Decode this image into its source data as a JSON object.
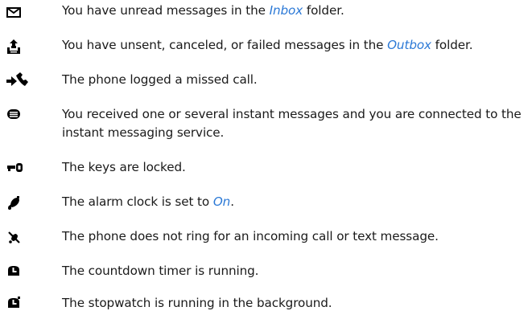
{
  "indicators": [
    {
      "icon": "envelope-icon",
      "pre": "You have unread messages in the ",
      "link": "Inbox",
      "post": " folder."
    },
    {
      "icon": "outbox-icon",
      "pre": "You have unsent, canceled, or failed messages in the ",
      "link": "Outbox",
      "post": " folder."
    },
    {
      "icon": "missed-call-icon",
      "pre": "The phone logged a missed call.",
      "link": "",
      "post": ""
    },
    {
      "icon": "instant-message-icon",
      "pre": "You received one or several instant messages and you are connected to the instant messaging service.",
      "link": "",
      "post": ""
    },
    {
      "icon": "key-lock-icon",
      "pre": "The keys are locked.",
      "link": "",
      "post": ""
    },
    {
      "icon": "alarm-clock-icon",
      "pre": "The alarm clock is set to ",
      "link": "On",
      "post": "."
    },
    {
      "icon": "silent-ring-icon",
      "pre": "The phone does not ring for an incoming call or text message.",
      "link": "",
      "post": ""
    },
    {
      "icon": "countdown-timer-icon",
      "pre": "The countdown timer is running.",
      "link": "",
      "post": ""
    },
    {
      "icon": "stopwatch-icon",
      "pre": "The stopwatch is running in the background.",
      "link": "",
      "post": ""
    }
  ],
  "colors": {
    "text": "#1a1a1a",
    "link": "#2a78d6",
    "icon": "#000000"
  }
}
